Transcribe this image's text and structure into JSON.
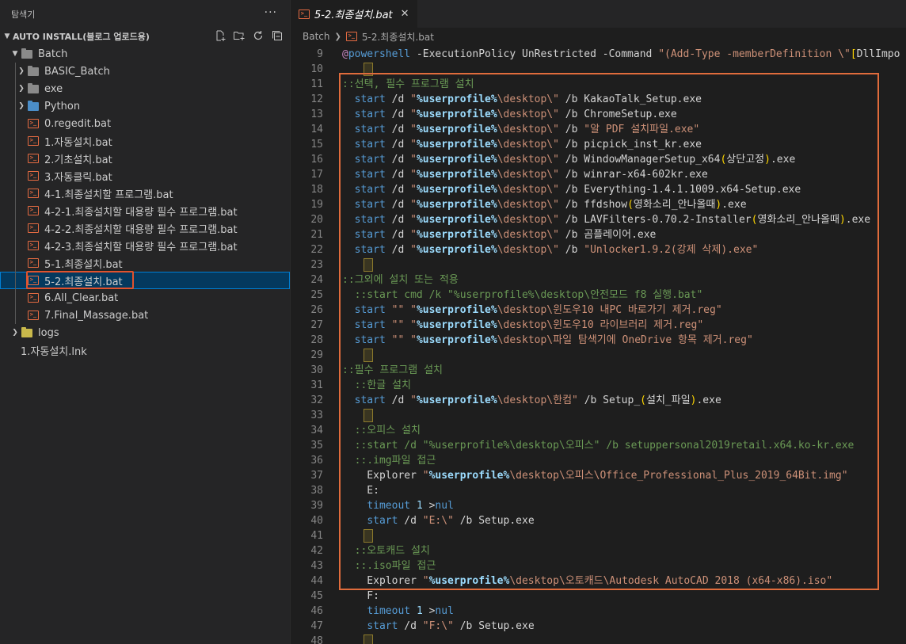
{
  "explorer": {
    "title": "탐색기",
    "more": "···",
    "section_title": "AUTO INSTALL(블로그 업로드용)",
    "actions": [
      "new-file-icon",
      "new-folder-icon",
      "refresh-icon",
      "collapse-all-icon"
    ],
    "tree": [
      {
        "label": "Batch",
        "type": "folder-open",
        "depth": 1
      },
      {
        "label": "BASIC_Batch",
        "type": "folder",
        "depth": 2
      },
      {
        "label": "exe",
        "type": "folder",
        "depth": 2
      },
      {
        "label": "Python",
        "type": "folder-python",
        "depth": 2
      },
      {
        "label": "0.regedit.bat",
        "type": "bat",
        "depth": 2
      },
      {
        "label": "1.자동설치.bat",
        "type": "bat",
        "depth": 2
      },
      {
        "label": "2.기초설치.bat",
        "type": "bat",
        "depth": 2
      },
      {
        "label": "3.자동클릭.bat",
        "type": "bat",
        "depth": 2
      },
      {
        "label": "4-1.최종설치할 프로그램.bat",
        "type": "bat",
        "depth": 2
      },
      {
        "label": "4-2-1.최종설치할 대용량 필수 프로그램.bat",
        "type": "bat",
        "depth": 2
      },
      {
        "label": "4-2-2.최종설치할 대용량 필수 프로그램.bat",
        "type": "bat",
        "depth": 2
      },
      {
        "label": "4-2-3.최종설치할 대용량 필수 프로그램.bat",
        "type": "bat",
        "depth": 2
      },
      {
        "label": "5-1.최종설치.bat",
        "type": "bat",
        "depth": 2
      },
      {
        "label": "5-2.최종설치.bat",
        "type": "bat",
        "depth": 2,
        "selected": true
      },
      {
        "label": "6.All_Clear.bat",
        "type": "bat",
        "depth": 2
      },
      {
        "label": "7.Final_Massage.bat",
        "type": "bat",
        "depth": 2
      },
      {
        "label": "logs",
        "type": "folder-logs",
        "depth": 1
      },
      {
        "label": "1.자동설치.lnk",
        "type": "lnk",
        "depth": 1
      }
    ]
  },
  "editor": {
    "tab_label": "5-2.최종설치.bat",
    "breadcrumb": [
      "Batch",
      "5-2.최종설치.bat"
    ],
    "lines": [
      {
        "n": "9",
        "tokens": [
          [
            "c-at",
            "@"
          ],
          [
            "c-kw",
            "powershell"
          ],
          [
            "c-pl",
            " -ExecutionPolicy UnRestricted -Command "
          ],
          [
            "c-str",
            "\"(Add-Type -memberDefinition \\\""
          ],
          [
            "c-br",
            "["
          ],
          [
            "c-pl",
            "DllImpo"
          ]
        ]
      },
      {
        "n": "10",
        "tokens": []
      },
      {
        "n": "11",
        "tokens": [
          [
            "c-com",
            "::선택, 필수 프로그램 설치"
          ]
        ]
      },
      {
        "n": "12",
        "tokens": [
          [
            "c-pl",
            "  "
          ],
          [
            "c-kw",
            "start"
          ],
          [
            "c-pl",
            " /d "
          ],
          [
            "c-str",
            "\""
          ],
          [
            "c-var",
            "%userprofile%"
          ],
          [
            "c-str",
            "\\desktop\\\""
          ],
          [
            "c-pl",
            " /b KakaoTalk_Setup.exe"
          ]
        ]
      },
      {
        "n": "13",
        "tokens": [
          [
            "c-pl",
            "  "
          ],
          [
            "c-kw",
            "start"
          ],
          [
            "c-pl",
            " /d "
          ],
          [
            "c-str",
            "\""
          ],
          [
            "c-var",
            "%userprofile%"
          ],
          [
            "c-str",
            "\\desktop\\\""
          ],
          [
            "c-pl",
            " /b ChromeSetup.exe"
          ]
        ]
      },
      {
        "n": "14",
        "tokens": [
          [
            "c-pl",
            "  "
          ],
          [
            "c-kw",
            "start"
          ],
          [
            "c-pl",
            " /d "
          ],
          [
            "c-str",
            "\""
          ],
          [
            "c-var",
            "%userprofile%"
          ],
          [
            "c-str",
            "\\desktop\\\""
          ],
          [
            "c-pl",
            " /b "
          ],
          [
            "c-str",
            "\"알 PDF 설치파일.exe\""
          ]
        ]
      },
      {
        "n": "15",
        "tokens": [
          [
            "c-pl",
            "  "
          ],
          [
            "c-kw",
            "start"
          ],
          [
            "c-pl",
            " /d "
          ],
          [
            "c-str",
            "\""
          ],
          [
            "c-var",
            "%userprofile%"
          ],
          [
            "c-str",
            "\\desktop\\\""
          ],
          [
            "c-pl",
            " /b picpick_inst_kr.exe"
          ]
        ]
      },
      {
        "n": "16",
        "tokens": [
          [
            "c-pl",
            "  "
          ],
          [
            "c-kw",
            "start"
          ],
          [
            "c-pl",
            " /d "
          ],
          [
            "c-str",
            "\""
          ],
          [
            "c-var",
            "%userprofile%"
          ],
          [
            "c-str",
            "\\desktop\\\""
          ],
          [
            "c-pl",
            " /b WindowManagerSetup_x64"
          ],
          [
            "c-br",
            "("
          ],
          [
            "c-pl",
            "상단고정"
          ],
          [
            "c-br",
            ")"
          ],
          [
            "c-pl",
            ".exe"
          ]
        ]
      },
      {
        "n": "17",
        "tokens": [
          [
            "c-pl",
            "  "
          ],
          [
            "c-kw",
            "start"
          ],
          [
            "c-pl",
            " /d "
          ],
          [
            "c-str",
            "\""
          ],
          [
            "c-var",
            "%userprofile%"
          ],
          [
            "c-str",
            "\\desktop\\\""
          ],
          [
            "c-pl",
            " /b winrar-x64-602kr.exe"
          ]
        ]
      },
      {
        "n": "18",
        "tokens": [
          [
            "c-pl",
            "  "
          ],
          [
            "c-kw",
            "start"
          ],
          [
            "c-pl",
            " /d "
          ],
          [
            "c-str",
            "\""
          ],
          [
            "c-var",
            "%userprofile%"
          ],
          [
            "c-str",
            "\\desktop\\\""
          ],
          [
            "c-pl",
            " /b Everything-1.4.1.1009.x64-Setup.exe"
          ]
        ]
      },
      {
        "n": "19",
        "tokens": [
          [
            "c-pl",
            "  "
          ],
          [
            "c-kw",
            "start"
          ],
          [
            "c-pl",
            " /d "
          ],
          [
            "c-str",
            "\""
          ],
          [
            "c-var",
            "%userprofile%"
          ],
          [
            "c-str",
            "\\desktop\\\""
          ],
          [
            "c-pl",
            " /b ffdshow"
          ],
          [
            "c-br",
            "("
          ],
          [
            "c-pl",
            "영화소리_안나올때"
          ],
          [
            "c-br",
            ")"
          ],
          [
            "c-pl",
            ".exe"
          ]
        ]
      },
      {
        "n": "20",
        "tokens": [
          [
            "c-pl",
            "  "
          ],
          [
            "c-kw",
            "start"
          ],
          [
            "c-pl",
            " /d "
          ],
          [
            "c-str",
            "\""
          ],
          [
            "c-var",
            "%userprofile%"
          ],
          [
            "c-str",
            "\\desktop\\\""
          ],
          [
            "c-pl",
            " /b LAVFilters-0.70.2-Installer"
          ],
          [
            "c-br",
            "("
          ],
          [
            "c-pl",
            "영화소리_안나올때"
          ],
          [
            "c-br",
            ")"
          ],
          [
            "c-pl",
            ".exe"
          ]
        ]
      },
      {
        "n": "21",
        "tokens": [
          [
            "c-pl",
            "  "
          ],
          [
            "c-kw",
            "start"
          ],
          [
            "c-pl",
            " /d "
          ],
          [
            "c-str",
            "\""
          ],
          [
            "c-var",
            "%userprofile%"
          ],
          [
            "c-str",
            "\\desktop\\\""
          ],
          [
            "c-pl",
            " /b 곰플레이어.exe"
          ]
        ]
      },
      {
        "n": "22",
        "tokens": [
          [
            "c-pl",
            "  "
          ],
          [
            "c-kw",
            "start"
          ],
          [
            "c-pl",
            " /d "
          ],
          [
            "c-str",
            "\""
          ],
          [
            "c-var",
            "%userprofile%"
          ],
          [
            "c-str",
            "\\desktop\\\""
          ],
          [
            "c-pl",
            " /b "
          ],
          [
            "c-str",
            "\"Unlocker1.9.2(강제 삭제).exe\""
          ]
        ]
      },
      {
        "n": "23",
        "tokens": []
      },
      {
        "n": "24",
        "tokens": [
          [
            "c-com",
            "::그외에 설치 또는 적용"
          ]
        ]
      },
      {
        "n": "25",
        "tokens": [
          [
            "c-pl",
            "  "
          ],
          [
            "c-com",
            "::start cmd /k \"%userprofile%\\desktop\\안전모드 f8 실행.bat\""
          ]
        ]
      },
      {
        "n": "26",
        "tokens": [
          [
            "c-pl",
            "  "
          ],
          [
            "c-kw",
            "start"
          ],
          [
            "c-pl",
            " "
          ],
          [
            "c-str",
            "\"\""
          ],
          [
            "c-pl",
            " "
          ],
          [
            "c-str",
            "\""
          ],
          [
            "c-var",
            "%userprofile%"
          ],
          [
            "c-str",
            "\\desktop\\윈도우10 내PC 바로가기 제거.reg\""
          ]
        ]
      },
      {
        "n": "27",
        "tokens": [
          [
            "c-pl",
            "  "
          ],
          [
            "c-kw",
            "start"
          ],
          [
            "c-pl",
            " "
          ],
          [
            "c-str",
            "\"\""
          ],
          [
            "c-pl",
            " "
          ],
          [
            "c-str",
            "\""
          ],
          [
            "c-var",
            "%userprofile%"
          ],
          [
            "c-str",
            "\\desktop\\윈도우10 라이브러리 제거.reg\""
          ]
        ]
      },
      {
        "n": "28",
        "tokens": [
          [
            "c-pl",
            "  "
          ],
          [
            "c-kw",
            "start"
          ],
          [
            "c-pl",
            " "
          ],
          [
            "c-str",
            "\"\""
          ],
          [
            "c-pl",
            " "
          ],
          [
            "c-str",
            "\""
          ],
          [
            "c-var",
            "%userprofile%"
          ],
          [
            "c-str",
            "\\desktop\\파일 탐색기에 OneDrive 항목 제거.reg\""
          ]
        ]
      },
      {
        "n": "29",
        "tokens": []
      },
      {
        "n": "30",
        "tokens": [
          [
            "c-com",
            "::필수 프로그램 설치"
          ]
        ]
      },
      {
        "n": "31",
        "tokens": [
          [
            "c-pl",
            "  "
          ],
          [
            "c-com",
            "::한글 설치"
          ]
        ]
      },
      {
        "n": "32",
        "tokens": [
          [
            "c-pl",
            "  "
          ],
          [
            "c-kw",
            "start"
          ],
          [
            "c-pl",
            " /d "
          ],
          [
            "c-str",
            "\""
          ],
          [
            "c-var",
            "%userprofile%"
          ],
          [
            "c-str",
            "\\desktop\\한컴\""
          ],
          [
            "c-pl",
            " /b Setup_"
          ],
          [
            "c-br",
            "("
          ],
          [
            "c-pl",
            "설치_파일"
          ],
          [
            "c-br",
            ")"
          ],
          [
            "c-pl",
            ".exe"
          ]
        ]
      },
      {
        "n": "33",
        "tokens": []
      },
      {
        "n": "34",
        "tokens": [
          [
            "c-pl",
            "  "
          ],
          [
            "c-com",
            "::오피스 설치"
          ]
        ]
      },
      {
        "n": "35",
        "tokens": [
          [
            "c-pl",
            "  "
          ],
          [
            "c-com",
            "::start /d \"%userprofile%\\desktop\\오피스\" /b setuppersonal2019retail.x64.ko-kr.exe"
          ]
        ]
      },
      {
        "n": "36",
        "tokens": [
          [
            "c-pl",
            "  "
          ],
          [
            "c-com",
            "::.img파일 접근"
          ]
        ]
      },
      {
        "n": "37",
        "tokens": [
          [
            "c-pl",
            "    Explorer "
          ],
          [
            "c-str",
            "\""
          ],
          [
            "c-var",
            "%userprofile%"
          ],
          [
            "c-str",
            "\\desktop\\오피스\\Office_Professional_Plus_2019_64Bit.img\""
          ]
        ]
      },
      {
        "n": "38",
        "tokens": [
          [
            "c-pl",
            "    E:"
          ]
        ]
      },
      {
        "n": "39",
        "tokens": [
          [
            "c-pl",
            "    "
          ],
          [
            "c-kw",
            "timeout"
          ],
          [
            "c-pl",
            " "
          ],
          [
            "c-var2",
            "1"
          ],
          [
            "c-pl",
            " >"
          ],
          [
            "c-kw",
            "nul"
          ]
        ]
      },
      {
        "n": "40",
        "tokens": [
          [
            "c-pl",
            "    "
          ],
          [
            "c-kw",
            "start"
          ],
          [
            "c-pl",
            " /d "
          ],
          [
            "c-str",
            "\"E:\\\""
          ],
          [
            "c-pl",
            " /b Setup.exe"
          ]
        ]
      },
      {
        "n": "41",
        "tokens": []
      },
      {
        "n": "42",
        "tokens": [
          [
            "c-pl",
            "  "
          ],
          [
            "c-com",
            "::오토캐드 설치"
          ]
        ]
      },
      {
        "n": "43",
        "tokens": [
          [
            "c-pl",
            "  "
          ],
          [
            "c-com",
            "::.iso파일 접근"
          ]
        ]
      },
      {
        "n": "44",
        "tokens": [
          [
            "c-pl",
            "    Explorer "
          ],
          [
            "c-str",
            "\""
          ],
          [
            "c-var",
            "%userprofile%"
          ],
          [
            "c-str",
            "\\desktop\\오토캐드\\Autodesk AutoCAD 2018 (x64-x86).iso\""
          ]
        ]
      },
      {
        "n": "45",
        "tokens": [
          [
            "c-pl",
            "    F:"
          ]
        ]
      },
      {
        "n": "46",
        "tokens": [
          [
            "c-pl",
            "    "
          ],
          [
            "c-kw",
            "timeout"
          ],
          [
            "c-pl",
            " "
          ],
          [
            "c-var2",
            "1"
          ],
          [
            "c-pl",
            " >"
          ],
          [
            "c-kw",
            "nul"
          ]
        ]
      },
      {
        "n": "47",
        "tokens": [
          [
            "c-pl",
            "    "
          ],
          [
            "c-kw",
            "start"
          ],
          [
            "c-pl",
            " /d "
          ],
          [
            "c-str",
            "\"F:\\\""
          ],
          [
            "c-pl",
            " /b Setup.exe"
          ]
        ]
      },
      {
        "n": "48",
        "tokens": []
      }
    ]
  }
}
